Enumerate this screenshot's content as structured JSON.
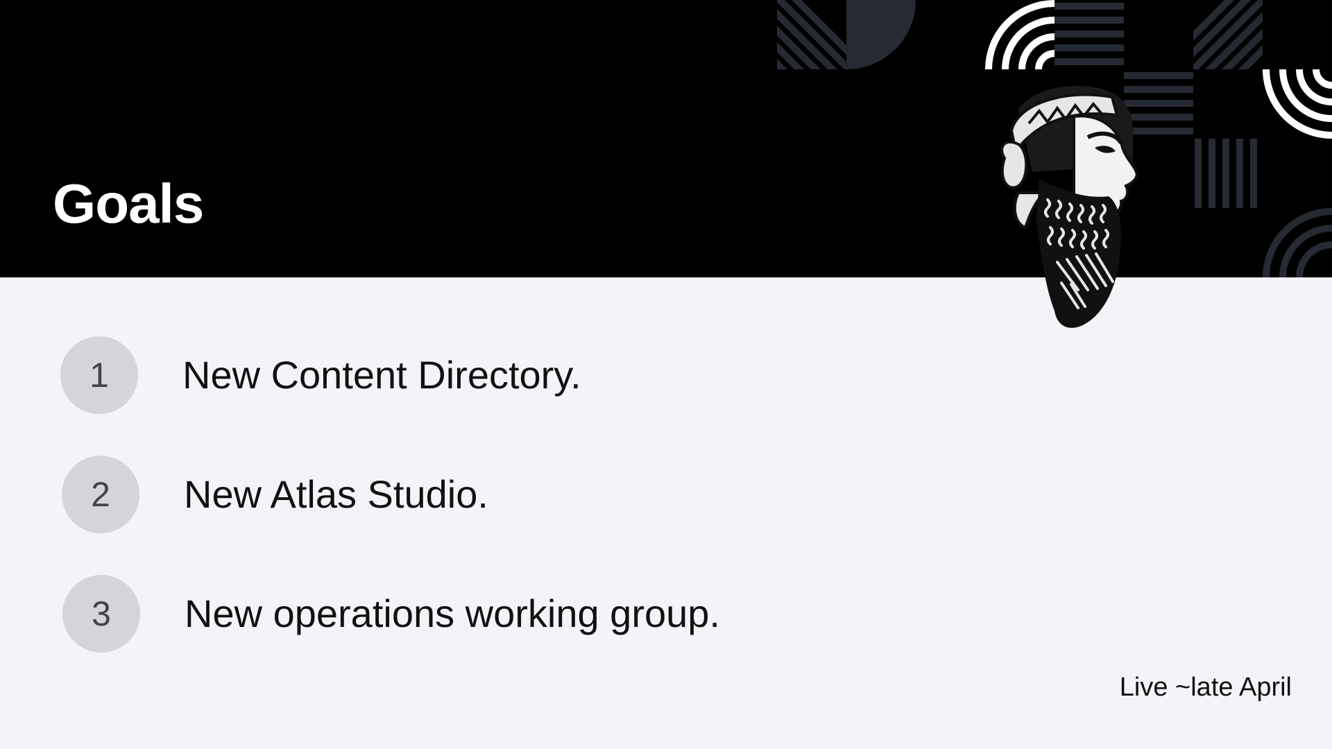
{
  "slide": {
    "title": "Goals",
    "note": "Live ~late April"
  },
  "goals": [
    {
      "number": "1",
      "text": "New Content Directory."
    },
    {
      "number": "2",
      "text": "New Atlas Studio."
    },
    {
      "number": "3",
      "text": "New operations working group."
    }
  ],
  "colors": {
    "header_background": "#000000",
    "body_background": "#f3f4f8",
    "number_badge": "#d4d5d9",
    "pattern_gray": "#262a33"
  },
  "icons": {
    "mascot": "bearded-king-head-illustration",
    "decor": "geometric-stripe-pattern"
  }
}
